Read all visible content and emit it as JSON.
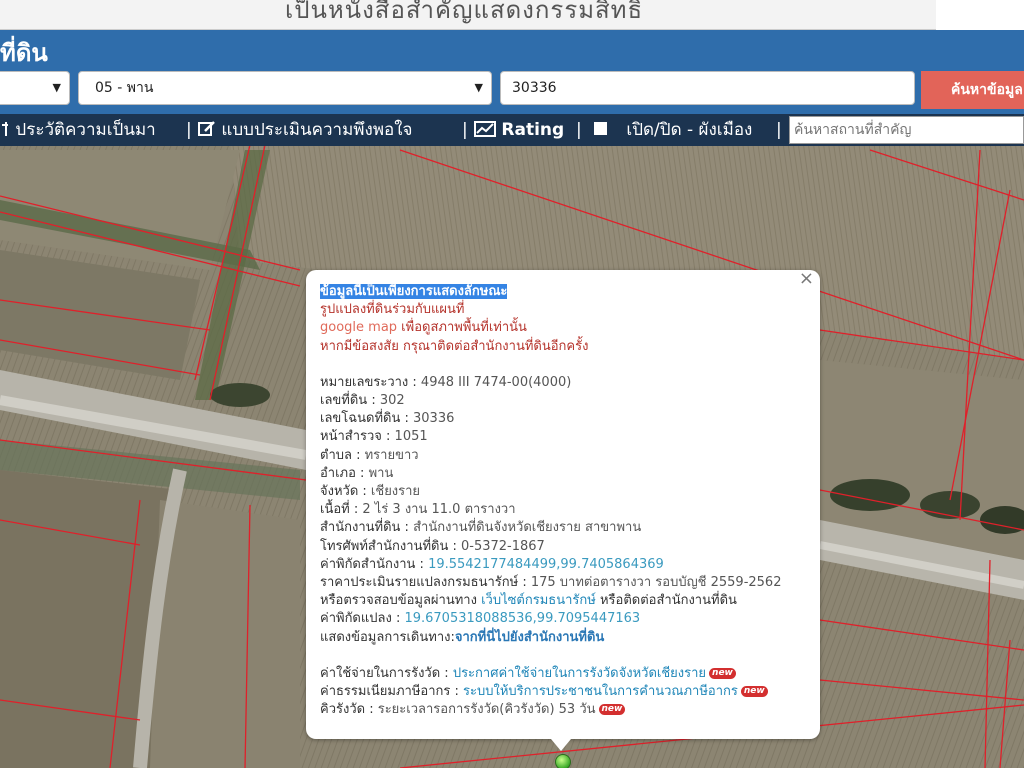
{
  "banner": {
    "text": "เป็นหนังสือสำคัญแสดงกรรมสิทธิ"
  },
  "header": {
    "title": "ที่ดิน"
  },
  "search": {
    "province_select": "",
    "district_select": "05 - พาน",
    "parcel_number": "30336",
    "search_button": "ค้นหาข้อมูล"
  },
  "menu": {
    "history": "ประวัติความเป็นมา",
    "survey": "แบบประเมินความพึงพอใจ",
    "rating": "Rating",
    "toggle_city_plan": "เปิด/ปิด - ผังเมือง",
    "place_search_placeholder": "ค้นหาสถานที่สำคัญ",
    "separator": "|"
  },
  "popup": {
    "notice_title": "ข้อมูลนี้เป็นเพียงการแสดงลักษณะ",
    "notice_line1": "รูปแปลงที่ดินร่วมกับแผนที่",
    "notice_line2_a": "google map",
    "notice_line2_b": " เพื่อดูสภาพพื้นที่เท่านั้น",
    "notice_line3": "หากมีข้อสงสัย กรุณาติดต่อสำนักงานที่ดินอีกครั้ง",
    "sheet_label": "หมายเลขระวาง : ",
    "sheet_value": "4948 III 7474-00(4000)",
    "land_no_label": "เลขที่ดิน : ",
    "land_no_value": "302",
    "deed_label": "เลขโฉนดที่ดิน : ",
    "deed_value": "30336",
    "survey_page_label": "หน้าสำรวจ : ",
    "survey_page_value": "1051",
    "subdistrict_label": "ตำบล : ",
    "subdistrict_value": "ทรายขาว",
    "district_label": "อำเภอ : ",
    "district_value": "พาน",
    "province_label": "จังหวัด : ",
    "province_value": "เชียงราย",
    "area_label": "เนื้อที่ : ",
    "area_value": "2 ไร่ 3 งาน 11.0 ตารางวา",
    "office_label": "สำนักงานที่ดิน : ",
    "office_value": "สำนักงานที่ดินจังหวัดเชียงราย สาขาพาน",
    "phone_label": "โทรศัพท์สำนักงานที่ดิน : ",
    "phone_value": "0-5372-1867",
    "office_coord_label": "ค่าพิกัดสำนักงาน : ",
    "office_coord_value": "19.5542177484499,99.7405864369",
    "price_label": "ราคาประเมินรายแปลงกรมธนารักษ์ : ",
    "price_value": "175 บาทต่อตารางวา รอบบัญชี 2559-2562",
    "check_a": "หรือตรวจสอบข้อมูลผ่านทาง ",
    "check_link": "เว็บไซต์กรมธนารักษ์",
    "check_b": " หรือติดต่อสำนักงานที่ดิน",
    "parcel_coord_label": "ค่าพิกัดแปลง : ",
    "parcel_coord_value": "19.6705318088536,99.7095447163",
    "route_label": "แสดงข้อมูลการเดินทาง:",
    "route_link": "จากที่นี่ไปยังสำนักงานที่ดิน",
    "fee_label": "ค่าใช้จ่ายในการรังวัด : ",
    "fee_link": "ประกาศค่าใช้จ่ายในการรังวัดจังหวัดเชียงราย",
    "tax_label": "ค่าธรรมเนียมภาษีอากร : ",
    "tax_link": "ระบบให้บริการประชาชนในการคำนวณภาษีอากร",
    "queue_label": "คิวรังวัด : ",
    "queue_value": "ระยะเวลารอการรังวัด(คิวรังวัด) 53 วัน",
    "new_badge": "new",
    "close": "×"
  },
  "colors": {
    "header_blue": "#2f6dab",
    "menu_navy": "#1c3450",
    "search_red": "#e26459",
    "parcel_line": "#e0202a"
  }
}
